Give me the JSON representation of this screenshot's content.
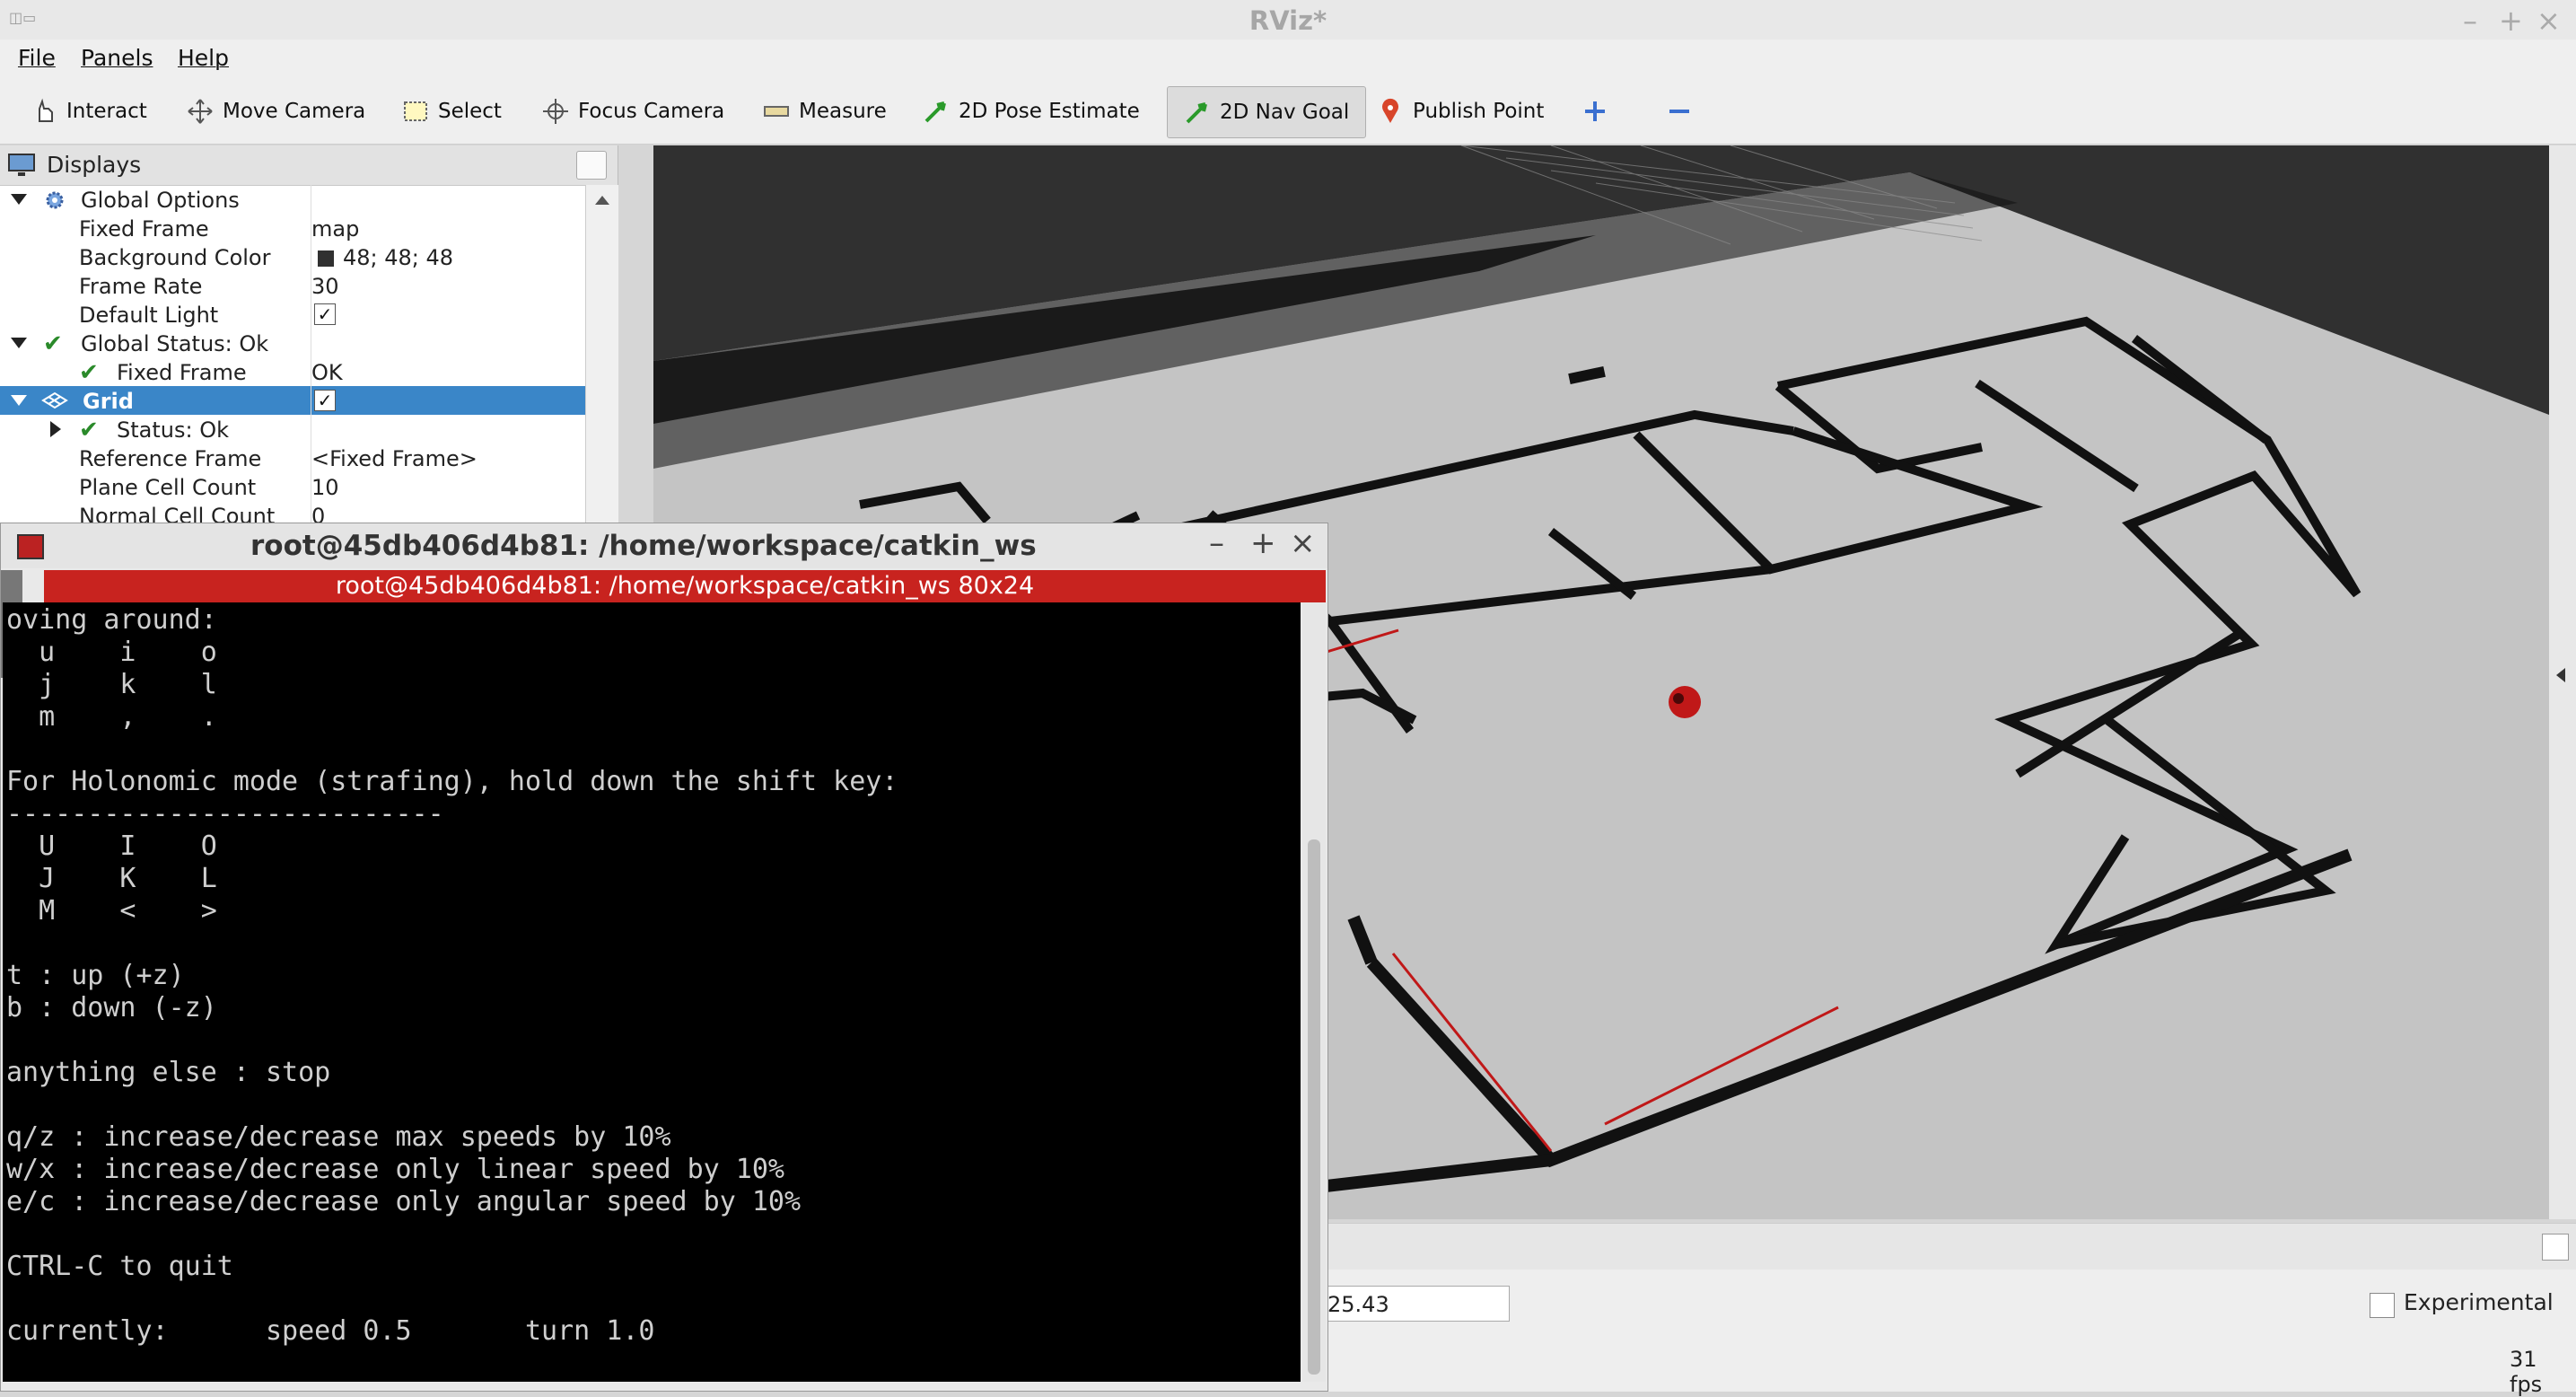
{
  "window": {
    "title": "RViz*"
  },
  "menu": {
    "items": [
      "File",
      "Panels",
      "Help"
    ]
  },
  "toolbar": {
    "tools": [
      "Interact",
      "Move Camera",
      "Select",
      "Focus Camera",
      "Measure",
      "2D Pose Estimate",
      "2D Nav Goal",
      "Publish Point"
    ],
    "active_tool": "2D Nav Goal",
    "add_icon": "plus-icon",
    "remove_icon": "minus-icon"
  },
  "displays": {
    "title": "Displays",
    "rows": [
      {
        "label": "Global Options",
        "value": ""
      },
      {
        "label": "Fixed Frame",
        "value": "map"
      },
      {
        "label": "Background Color",
        "value": "48; 48; 48"
      },
      {
        "label": "Frame Rate",
        "value": "30"
      },
      {
        "label": "Default Light",
        "value": "✓"
      },
      {
        "label": "Global Status: Ok",
        "value": ""
      },
      {
        "label": "Fixed Frame",
        "value": "OK"
      },
      {
        "label": "Grid",
        "value": "✓"
      },
      {
        "label": "Status: Ok",
        "value": ""
      },
      {
        "label": "Reference Frame",
        "value": "<Fixed Frame>"
      },
      {
        "label": "Plane Cell Count",
        "value": "10"
      },
      {
        "label": "Normal Cell Count",
        "value": "0"
      }
    ],
    "background_color_swatch": "#303030",
    "selected_color": "#3a86c8"
  },
  "terminal": {
    "title": "root@45db406d4b81: /home/workspace/catkin_ws",
    "tab": "root@45db406d4b81: /home/workspace/catkin_ws 80x24",
    "lines": [
      "oving around:",
      "  u    i    o",
      "  j    k    l",
      "  m    ,    .",
      "",
      "For Holonomic mode (strafing), hold down the shift key:",
      "---------------------------",
      "  U    I    O",
      "  J    K    L",
      "  M    <    >",
      "",
      "t : up (+z)",
      "b : down (-z)",
      "",
      "anything else : stop",
      "",
      "q/z : increase/decrease max speeds by 10%",
      "w/x : increase/decrease only linear speed by 10%",
      "e/c : increase/decrease only angular speed by 10%",
      "",
      "CTRL-C to quit",
      "",
      "currently:      speed 0.5       turn 1.0"
    ],
    "tab_color": "#c8231f"
  },
  "status": {
    "coords_value": "25.43",
    "experimental_label": "Experimental",
    "fps": "31 fps"
  },
  "colors": {
    "viewport_bg": "#303030",
    "map_floor": "#c4c4c4",
    "walls": "#111111",
    "robot": "#c01818"
  }
}
